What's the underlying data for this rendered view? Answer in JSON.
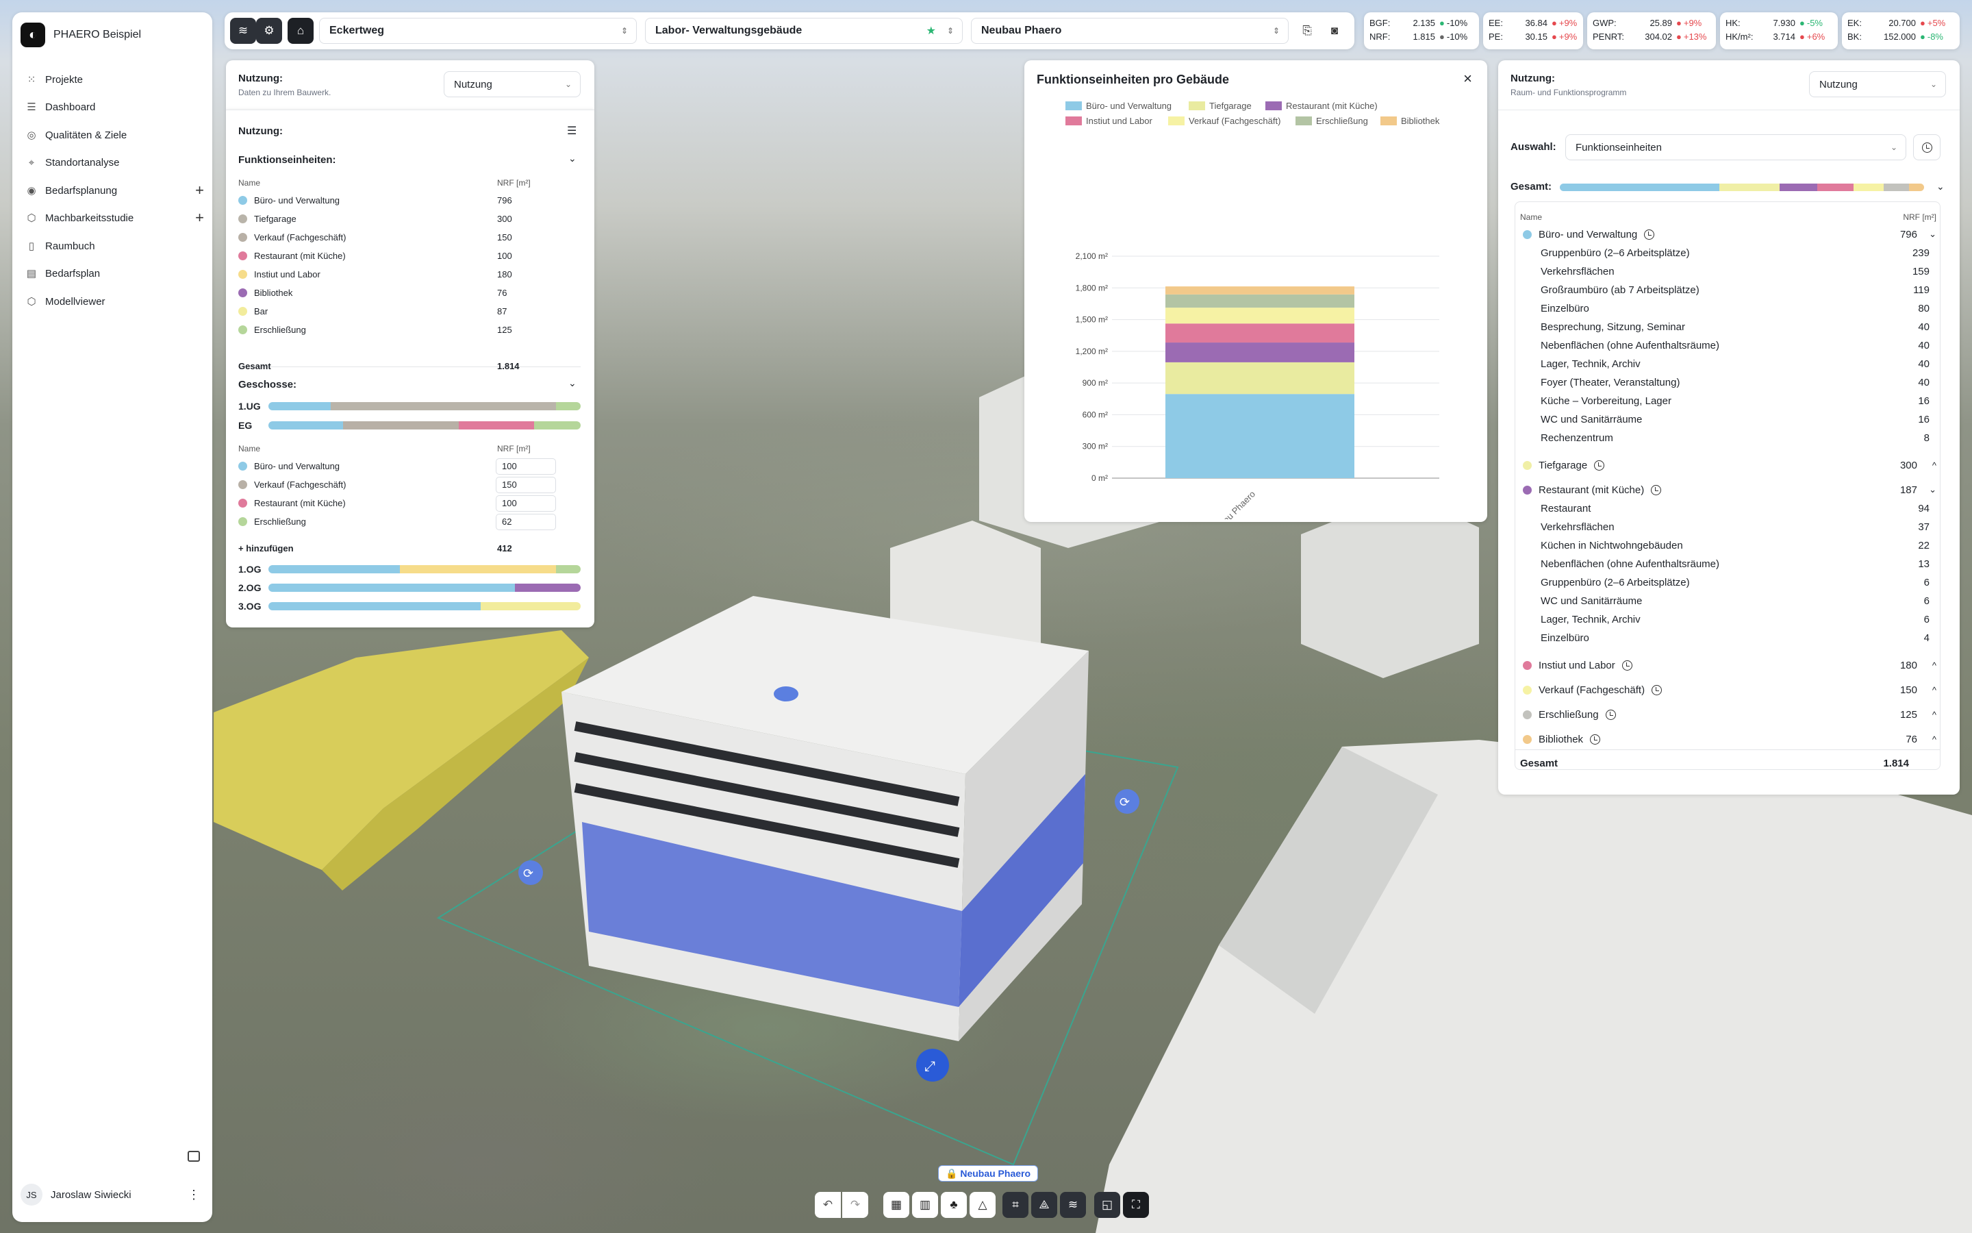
{
  "app": {
    "name": "PHAERO Beispiel",
    "user_initials": "JS",
    "user_name": "Jaroslaw Siwiecki"
  },
  "sidebar": {
    "items": [
      {
        "label": "Projekte",
        "icon": "grid-icon"
      },
      {
        "label": "Dashboard",
        "icon": "list-icon"
      },
      {
        "label": "Qualitäten & Ziele",
        "icon": "target-icon"
      },
      {
        "label": "Standortanalyse",
        "icon": "pin-icon"
      },
      {
        "label": "Bedarfsplanung",
        "icon": "compass-icon",
        "plus": "+"
      },
      {
        "label": "Machbarkeitsstudie",
        "icon": "cube-icon",
        "plus": "+"
      },
      {
        "label": "Raumbuch",
        "icon": "book-icon"
      },
      {
        "label": "Bedarfsplan",
        "icon": "clipboard-icon"
      },
      {
        "label": "Modellviewer",
        "icon": "cube-icon"
      }
    ]
  },
  "topbar": {
    "street": "Eckertweg",
    "building": "Labor- Verwaltungsgebäude",
    "variant": "Neubau Phaero"
  },
  "kpis": [
    {
      "rows": [
        {
          "k": "BGF:",
          "v": "2.135",
          "d": "-10%",
          "dir": "dn"
        },
        {
          "k": "NRF:",
          "v": "1.815",
          "d": "-10%",
          "dir": "gray"
        }
      ]
    },
    {
      "rows": [
        {
          "k": "EE:",
          "v": "36.84",
          "d": "+9%",
          "dir": "up"
        },
        {
          "k": "PE:",
          "v": "30.15",
          "d": "+9%",
          "dir": "up"
        }
      ]
    },
    {
      "rows": [
        {
          "k": "GWP:",
          "v": "25.89",
          "d": "+9%",
          "dir": "up"
        },
        {
          "k": "PENRT:",
          "v": "304.02",
          "d": "+13%",
          "dir": "up"
        }
      ]
    },
    {
      "rows": [
        {
          "k": "HK:",
          "v": "7.930",
          "d": "-5%",
          "dir": "dn"
        },
        {
          "k": "HK/m²:",
          "v": "3.714",
          "d": "+6%",
          "dir": "up"
        }
      ]
    },
    {
      "rows": [
        {
          "k": "EK:",
          "v": "20.700",
          "d": "+5%",
          "dir": "up"
        },
        {
          "k": "BK:",
          "v": "152.000",
          "d": "-8%",
          "dir": "dn"
        }
      ]
    }
  ],
  "left": {
    "title": "Nutzung:",
    "subtitle": "Daten zu Ihrem Bauwerk.",
    "dropdown": "Nutzung",
    "section": "Nutzung:",
    "fe_title": "Funktionseinheiten:",
    "col_name": "Name",
    "col_nrf": "NRF [m²]",
    "fe": [
      {
        "name": "Büro- und Verwaltung",
        "val": "796",
        "color": "#8ecae6"
      },
      {
        "name": "Tiefgarage",
        "val": "300",
        "color": "#b9b4aa"
      },
      {
        "name": "Verkauf (Fachgeschäft)",
        "val": "150",
        "color": "#b8b0a6"
      },
      {
        "name": "Restaurant (mit Küche)",
        "val": "100",
        "color": "#e07a9b"
      },
      {
        "name": "Instiut und Labor",
        "val": "180",
        "color": "#f6dc8a"
      },
      {
        "name": "Bibliothek",
        "val": "76",
        "color": "#9b6bb3"
      },
      {
        "name": "Bar",
        "val": "87",
        "color": "#f2ec9c"
      },
      {
        "name": "Erschließung",
        "val": "125",
        "color": "#b5d69a"
      }
    ],
    "total_label": "Gesamt",
    "total": "1.814",
    "floors_title": "Geschosse:",
    "floor_1ug": "1.UG",
    "floor_eg": "EG",
    "eg_rows": [
      {
        "name": "Büro- und Verwaltung",
        "val": "100",
        "color": "#8ecae6"
      },
      {
        "name": "Verkauf (Fachgeschäft)",
        "val": "150",
        "color": "#b8b0a6"
      },
      {
        "name": "Restaurant (mit Küche)",
        "val": "100",
        "color": "#e07a9b"
      },
      {
        "name": "Erschließung",
        "val": "62",
        "color": "#b5d69a"
      }
    ],
    "add_label": "+ hinzufügen",
    "add_total": "412",
    "floor_1og": "1.OG",
    "floor_2og": "2.OG",
    "floor_3og": "3.OG"
  },
  "chart_panel": {
    "close": "×"
  },
  "chart_data": {
    "type": "bar",
    "stacked": true,
    "title": "Funktionseinheiten pro Gebäude",
    "categories": [
      "Neubau Phaero"
    ],
    "yticks": [
      "0 m²",
      "300 m²",
      "600 m²",
      "900 m²",
      "1,200 m²",
      "1,500 m²",
      "1,800 m²",
      "2,100 m²"
    ],
    "ylim": [
      0,
      2100
    ],
    "legend": [
      {
        "name": "Büro- und Verwaltung",
        "color": "#8ecae6"
      },
      {
        "name": "Tiefgarage",
        "color": "#e9eba0"
      },
      {
        "name": "Restaurant (mit Küche)",
        "color": "#9b6bb3"
      },
      {
        "name": "Instiut und Labor",
        "color": "#e07a9b"
      },
      {
        "name": "Verkauf (Fachgeschäft)",
        "color": "#f6f2a4"
      },
      {
        "name": "Erschließung",
        "color": "#b3c4a4"
      },
      {
        "name": "Bibliothek",
        "color": "#f2c98a"
      }
    ],
    "series": [
      {
        "name": "Büro- und Verwaltung",
        "values": [
          796
        ],
        "color": "#8ecae6"
      },
      {
        "name": "Tiefgarage",
        "values": [
          300
        ],
        "color": "#e9eba0"
      },
      {
        "name": "Restaurant (mit Küche)",
        "values": [
          187
        ],
        "color": "#9b6bb3"
      },
      {
        "name": "Instiut und Labor",
        "values": [
          180
        ],
        "color": "#e07a9b"
      },
      {
        "name": "Verkauf (Fachgeschäft)",
        "values": [
          150
        ],
        "color": "#f6f2a4"
      },
      {
        "name": "Erschließung",
        "values": [
          125
        ],
        "color": "#b3c4a4"
      },
      {
        "name": "Bibliothek",
        "values": [
          76
        ],
        "color": "#f2c98a"
      }
    ]
  },
  "right": {
    "title": "Nutzung:",
    "subtitle": "Raum- und Funktionsprogramm",
    "dropdown": "Nutzung",
    "auswahl_label": "Auswahl:",
    "auswahl": "Funktionseinheiten",
    "gesamt_label": "Gesamt:",
    "col_name": "Name",
    "col_nrf": "NRF [m²]",
    "groups": [
      {
        "name": "Büro- und Verwaltung",
        "val": "796",
        "color": "#8ecae6",
        "caret": "⌄",
        "children": [
          {
            "name": "Gruppenbüro (2–6 Arbeitsplätze)",
            "val": "239"
          },
          {
            "name": "Verkehrsflächen",
            "val": "159"
          },
          {
            "name": "Großraumbüro (ab 7 Arbeitsplätze)",
            "val": "119"
          },
          {
            "name": "Einzelbüro",
            "val": "80"
          },
          {
            "name": "Besprechung, Sitzung, Seminar",
            "val": "40"
          },
          {
            "name": "Nebenflächen (ohne Aufenthaltsräume)",
            "val": "40"
          },
          {
            "name": "Lager, Technik, Archiv",
            "val": "40"
          },
          {
            "name": "Foyer (Theater, Veranstaltung)",
            "val": "40"
          },
          {
            "name": "Küche – Vorbereitung, Lager",
            "val": "16"
          },
          {
            "name": "WC und Sanitärräume",
            "val": "16"
          },
          {
            "name": "Rechenzentrum",
            "val": "8"
          }
        ]
      },
      {
        "name": "Tiefgarage",
        "val": "300",
        "color": "#f0efa6",
        "caret": "^",
        "children": []
      },
      {
        "name": "Restaurant (mit Küche)",
        "val": "187",
        "color": "#9b6bb3",
        "caret": "⌄",
        "children": [
          {
            "name": "Restaurant",
            "val": "94"
          },
          {
            "name": "Verkehrsflächen",
            "val": "37"
          },
          {
            "name": "Küchen in Nichtwohngebäuden",
            "val": "22"
          },
          {
            "name": "Nebenflächen (ohne Aufenthaltsräume)",
            "val": "13"
          },
          {
            "name": "Gruppenbüro (2–6 Arbeitsplätze)",
            "val": "6"
          },
          {
            "name": "WC und Sanitärräume",
            "val": "6"
          },
          {
            "name": "Lager, Technik, Archiv",
            "val": "6"
          },
          {
            "name": "Einzelbüro",
            "val": "4"
          }
        ]
      },
      {
        "name": "Instiut und Labor",
        "val": "180",
        "color": "#e07a9b",
        "caret": "^",
        "children": []
      },
      {
        "name": "Verkauf (Fachgeschäft)",
        "val": "150",
        "color": "#f6f2a4",
        "caret": "^",
        "children": []
      },
      {
        "name": "Erschließung",
        "val": "125",
        "color": "#c2c2bd",
        "caret": "^",
        "children": []
      },
      {
        "name": "Bibliothek",
        "val": "76",
        "color": "#f2c98a",
        "caret": "^",
        "children": []
      }
    ],
    "total_label": "Gesamt",
    "total": "1.814"
  },
  "scene": {
    "building_tag": "Neubau Phaero"
  }
}
